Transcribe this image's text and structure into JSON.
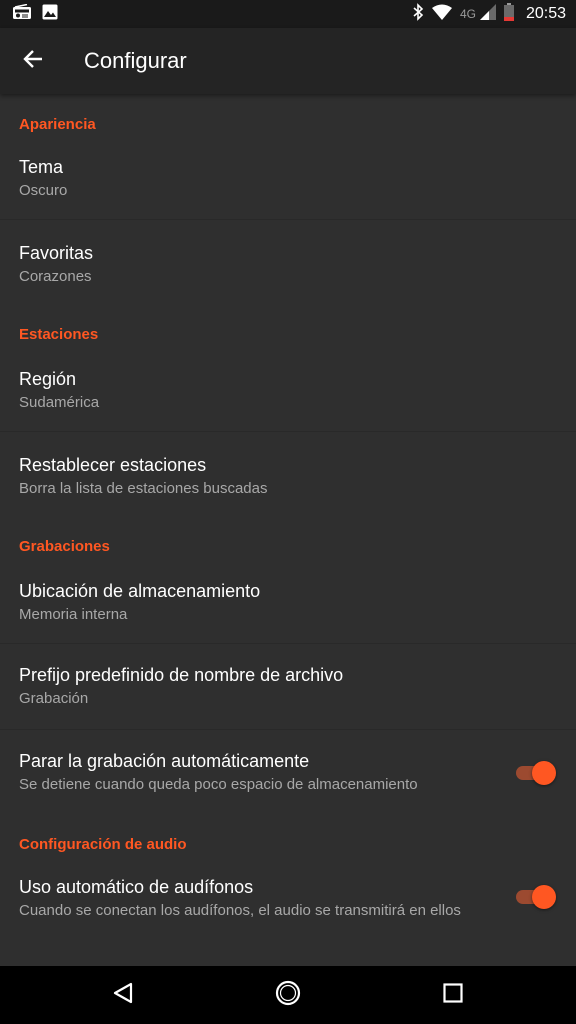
{
  "status_bar": {
    "network_label": "4G",
    "time": "20:53",
    "icons": [
      "radio-icon",
      "image-icon",
      "bluetooth-icon",
      "wifi-icon",
      "signal-icon",
      "battery-icon"
    ]
  },
  "app_bar": {
    "title": "Configurar",
    "back_icon": "arrow-back-icon"
  },
  "sections": {
    "appearance": {
      "header": "Apariencia",
      "theme": {
        "title": "Tema",
        "summary": "Oscuro"
      },
      "favorites": {
        "title": "Favoritas",
        "summary": "Corazones"
      }
    },
    "stations": {
      "header": "Estaciones",
      "region": {
        "title": "Región",
        "summary": "Sudamérica"
      },
      "reset": {
        "title": "Restablecer estaciones",
        "summary": "Borra la lista de estaciones buscadas"
      }
    },
    "recordings": {
      "header": "Grabaciones",
      "storage": {
        "title": "Ubicación de almacenamiento",
        "summary": "Memoria interna"
      },
      "prefix": {
        "title": "Prefijo predefinido de nombre de archivo",
        "summary": "Grabación"
      },
      "auto_stop": {
        "title": "Parar la grabación automáticamente",
        "summary": "Se detiene cuando queda poco espacio de almacenamiento",
        "enabled": true
      }
    },
    "audio": {
      "header": "Configuración de audio",
      "headphones": {
        "title": "Uso automático de audífonos",
        "summary": "Cuando se conectan los audífonos, el audio se transmitirá en ellos",
        "enabled": true
      }
    }
  },
  "nav_bar": {
    "back": "nav-back-icon",
    "home": "nav-home-icon",
    "recents": "nav-recents-icon"
  },
  "colors": {
    "accent": "#ff5722",
    "background": "#2f2f2f",
    "app_bar": "#242424",
    "status_bar": "#1a1a1a"
  }
}
